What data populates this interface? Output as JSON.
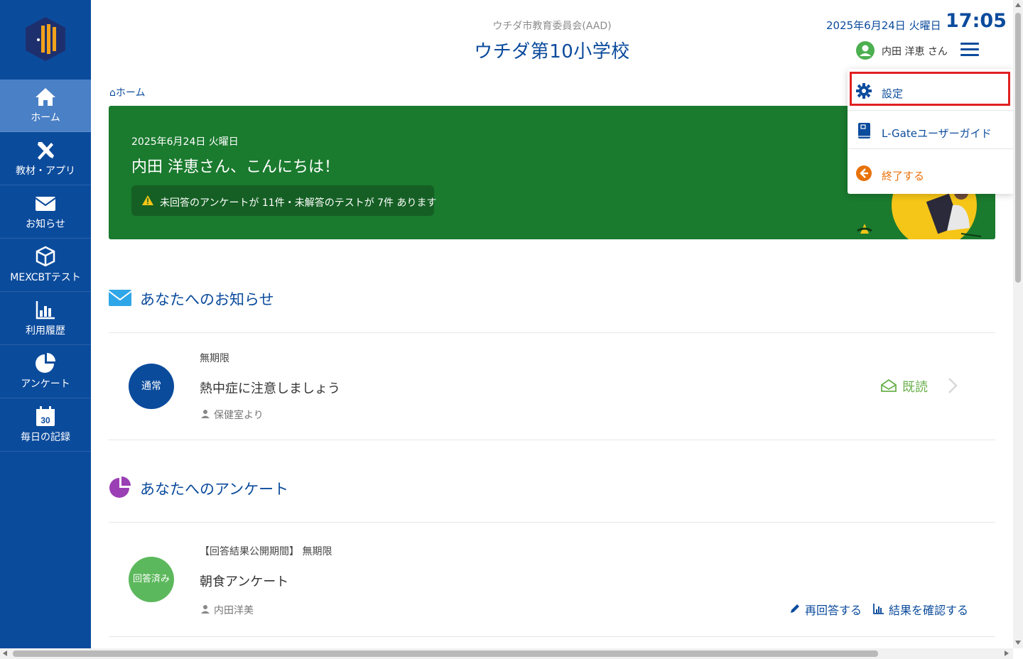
{
  "sidebar": {
    "items": [
      {
        "label": "ホーム"
      },
      {
        "label": "教材・アプリ"
      },
      {
        "label": "お知らせ"
      },
      {
        "label": "MEXCBTテスト"
      },
      {
        "label": "利用履歴"
      },
      {
        "label": "アンケート"
      },
      {
        "label": "毎日の記録",
        "badge": "30"
      }
    ]
  },
  "header": {
    "org": "ウチダ市教育委員会(AAD)",
    "school": "ウチダ第10小学校",
    "date": "2025年6月24日 火曜日",
    "time": "17:05",
    "user_name": "内田 洋恵 さん"
  },
  "breadcrumb": {
    "home": "ホーム"
  },
  "banner": {
    "date": "2025年6月24日 火曜日",
    "greeting": "内田 洋恵さん、こんにちは！",
    "alert": "未回答のアンケートが 11件・未解答のテストが 7件 あります"
  },
  "dropdown": {
    "settings": "設定",
    "guide": "L-Gateユーザーガイド",
    "logout": "終了する"
  },
  "notices": {
    "title": "あなたへのお知らせ",
    "item": {
      "badge": "通常",
      "period": "無期限",
      "title": "熱中症に注意しましょう",
      "from": "保健室より",
      "status": "既読"
    }
  },
  "surveys": {
    "title": "あなたへのアンケート",
    "item": {
      "badge": "回答済み",
      "period": "【回答結果公開期間】 無期限",
      "title": "朝食アンケート",
      "from": "内田洋美",
      "reanswer": "再回答する",
      "results": "結果を確認する"
    }
  },
  "colors": {
    "primary": "#0b4b9c",
    "sidebar_active": "#4a80c6",
    "banner": "#1a7a2e",
    "read": "#6ab04c",
    "logout": "#e8710a",
    "highlight": "#e02020"
  }
}
